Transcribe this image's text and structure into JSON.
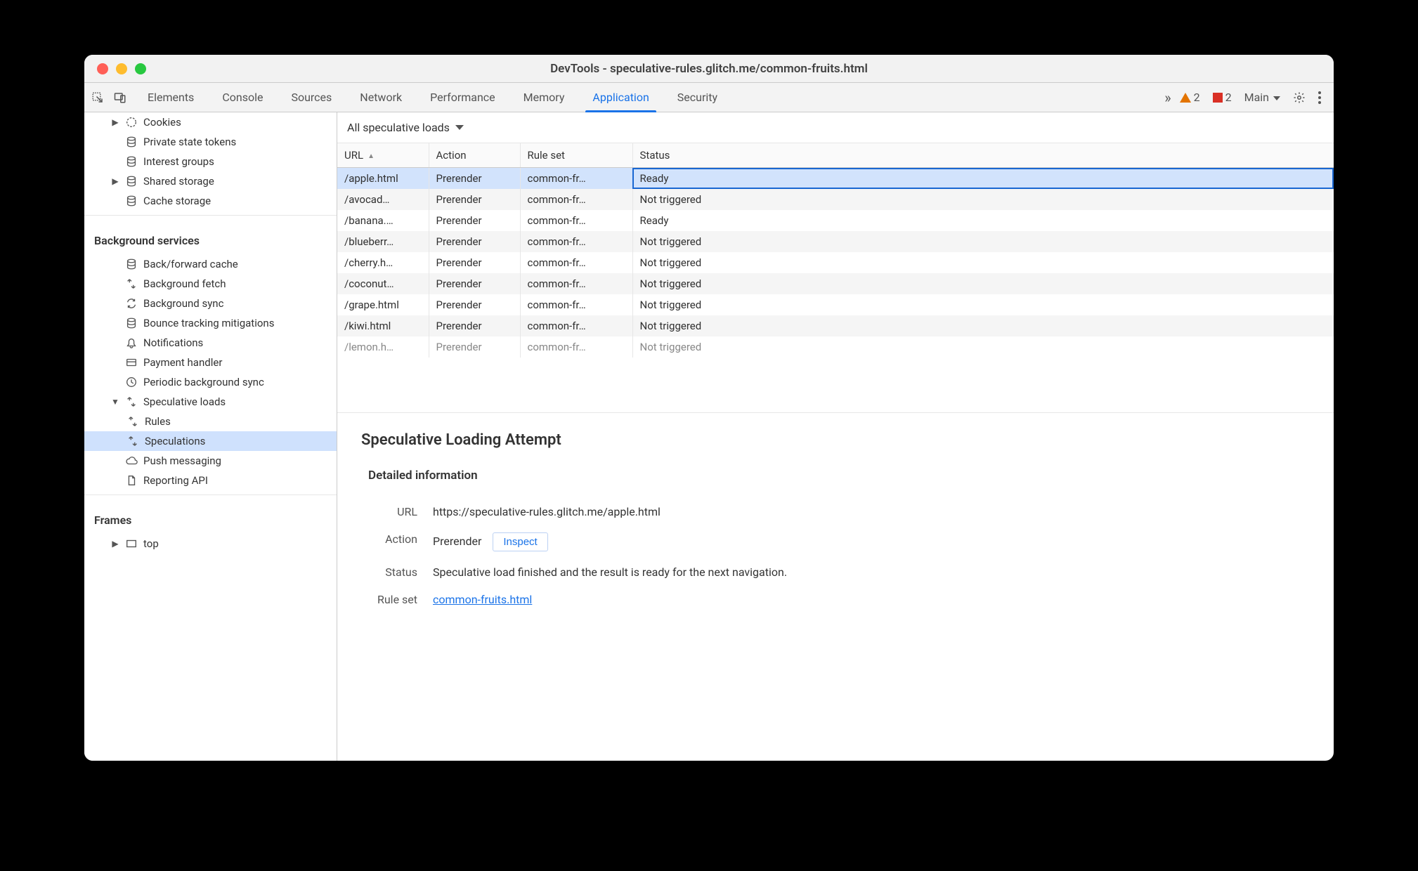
{
  "window": {
    "title": "DevTools - speculative-rules.glitch.me/common-fruits.html"
  },
  "tabs": {
    "items": [
      "Elements",
      "Console",
      "Sources",
      "Network",
      "Performance",
      "Memory",
      "Application",
      "Security"
    ],
    "active": "Application",
    "overflow_label": "»",
    "warnings": {
      "triangle": "2",
      "square": "2"
    },
    "target_label": "Main"
  },
  "sidebar": {
    "storage": {
      "cookies": "Cookies",
      "private_tokens": "Private state tokens",
      "interest_groups": "Interest groups",
      "shared_storage": "Shared storage",
      "cache_storage": "Cache storage"
    },
    "bg_title": "Background services",
    "bg": {
      "bf_cache": "Back/forward cache",
      "bg_fetch": "Background fetch",
      "bg_sync": "Background sync",
      "bounce": "Bounce tracking mitigations",
      "notifications": "Notifications",
      "payment": "Payment handler",
      "periodic": "Periodic background sync",
      "speculative": "Speculative loads",
      "rules": "Rules",
      "speculations": "Speculations",
      "push": "Push messaging",
      "reporting": "Reporting API"
    },
    "frames_title": "Frames",
    "frames_top": "top"
  },
  "main": {
    "filter_label": "All speculative loads",
    "columns": {
      "url": "URL",
      "action": "Action",
      "ruleset": "Rule set",
      "status": "Status"
    },
    "rows": [
      {
        "url": "/apple.html",
        "action": "Prerender",
        "ruleset": "common-fr…",
        "status": "Ready",
        "selected": true
      },
      {
        "url": "/avocad…",
        "action": "Prerender",
        "ruleset": "common-fr…",
        "status": "Not triggered"
      },
      {
        "url": "/banana.…",
        "action": "Prerender",
        "ruleset": "common-fr…",
        "status": "Ready"
      },
      {
        "url": "/blueberr…",
        "action": "Prerender",
        "ruleset": "common-fr…",
        "status": "Not triggered"
      },
      {
        "url": "/cherry.h…",
        "action": "Prerender",
        "ruleset": "common-fr…",
        "status": "Not triggered"
      },
      {
        "url": "/coconut…",
        "action": "Prerender",
        "ruleset": "common-fr…",
        "status": "Not triggered"
      },
      {
        "url": "/grape.html",
        "action": "Prerender",
        "ruleset": "common-fr…",
        "status": "Not triggered"
      },
      {
        "url": "/kiwi.html",
        "action": "Prerender",
        "ruleset": "common-fr…",
        "status": "Not triggered"
      },
      {
        "url": "/lemon.h…",
        "action": "Prerender",
        "ruleset": "common-fr…",
        "status": "Not triggered",
        "partial": true
      }
    ]
  },
  "detail": {
    "heading": "Speculative Loading Attempt",
    "subheading": "Detailed information",
    "labels": {
      "url": "URL",
      "action": "Action",
      "status": "Status",
      "ruleset": "Rule set"
    },
    "url": "https://speculative-rules.glitch.me/apple.html",
    "action": "Prerender",
    "inspect_label": "Inspect",
    "status": "Speculative load finished and the result is ready for the next navigation.",
    "ruleset_link": "common-fruits.html"
  }
}
